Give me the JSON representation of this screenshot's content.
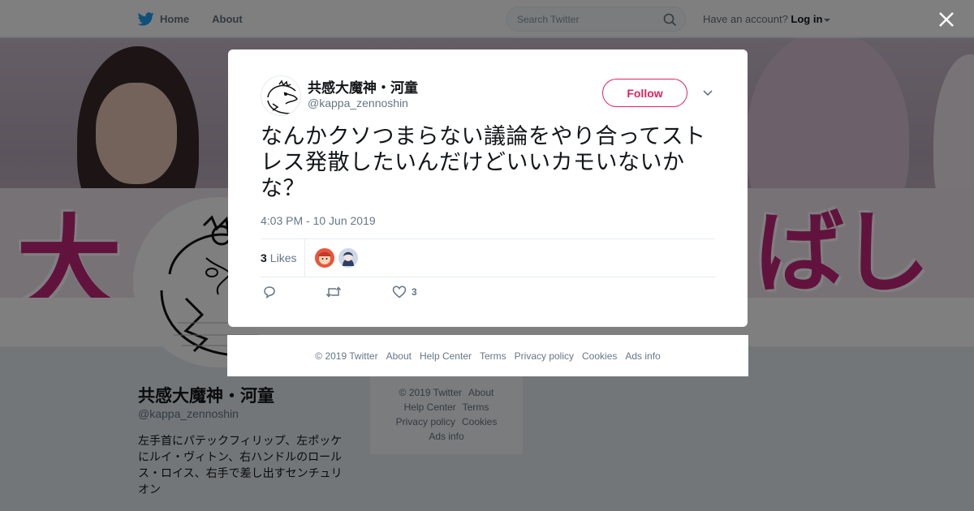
{
  "topbar": {
    "nav": [
      {
        "label": "Home",
        "icon": "twitter-bird-icon"
      },
      {
        "label": "About"
      }
    ],
    "search_placeholder": "Search Twitter",
    "account_prompt": "Have an account?",
    "login_label": "Log in"
  },
  "profile": {
    "name": "共感大魔神・河童",
    "handle": "@kappa_zennoshin",
    "bio": "左手首にパテックフィリップ、左ポッケにルイ・ヴィトン、右ハンドルのロールス・ロイス、右手で差し出すセンチュリオン"
  },
  "side_footer": {
    "line1": [
      "© 2019 Twitter",
      "About"
    ],
    "line2": [
      "Help Center",
      "Terms"
    ],
    "line3": [
      "Privacy policy",
      "Cookies"
    ],
    "line4": [
      "Ads info"
    ]
  },
  "tweet": {
    "author_name": "共感大魔神・河童",
    "author_handle": "@kappa_zennoshin",
    "follow_label": "Follow",
    "text": "なんかクソつまらない議論をやり合ってストレス発散したいんだけどいいカモいないかな？",
    "timestamp": "4:03 PM - 10 Jun 2019",
    "likes_count": "3",
    "likes_label": "Likes",
    "action_like_count": "3"
  },
  "modal_footer": [
    "© 2019 Twitter",
    "About",
    "Help Center",
    "Terms",
    "Privacy policy",
    "Cookies",
    "Ads info"
  ],
  "colors": {
    "accent": "#e0245e",
    "twitter_blue": "#1da1f2",
    "muted": "#657786",
    "banner_pink": "#c4267a"
  }
}
